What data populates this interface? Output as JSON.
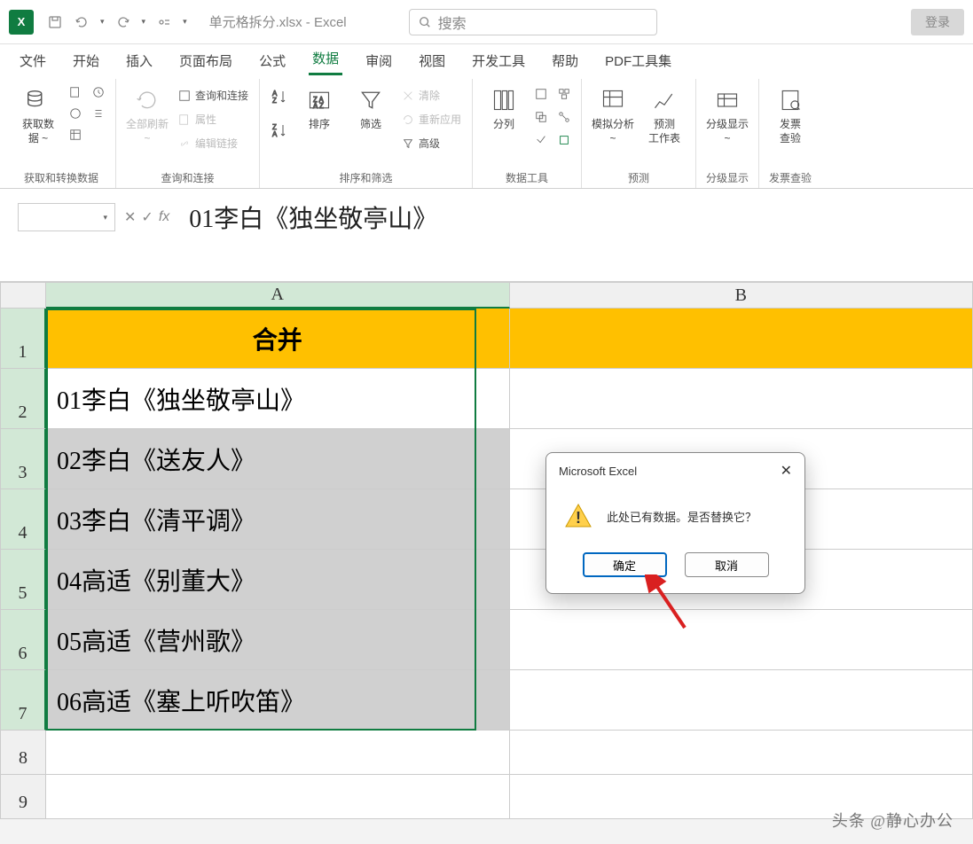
{
  "titlebar": {
    "app_logo": "X",
    "filename": "单元格拆分.xlsx",
    "app_name": "Excel",
    "title_sep": " - ",
    "search_placeholder": "搜索",
    "login_label": "登录"
  },
  "tabs": {
    "items": [
      {
        "label": "文件"
      },
      {
        "label": "开始"
      },
      {
        "label": "插入"
      },
      {
        "label": "页面布局"
      },
      {
        "label": "公式"
      },
      {
        "label": "数据",
        "active": true
      },
      {
        "label": "审阅"
      },
      {
        "label": "视图"
      },
      {
        "label": "开发工具"
      },
      {
        "label": "帮助"
      },
      {
        "label": "PDF工具集"
      }
    ]
  },
  "ribbon": {
    "groups": [
      {
        "label": "获取和转换数据",
        "btns": [
          {
            "t": "lg",
            "label": "获取数\n据 ~"
          }
        ]
      },
      {
        "label": "查询和连接",
        "btns": [
          {
            "t": "lg",
            "label": "全部刷新\n~",
            "disabled": true
          },
          {
            "t": "stack",
            "items": [
              {
                "label": "查询和连接"
              },
              {
                "label": "属性",
                "disabled": true
              },
              {
                "label": "编辑链接",
                "disabled": true
              }
            ]
          }
        ]
      },
      {
        "label": "排序和筛选",
        "btns": [
          {
            "t": "lg",
            "label": "排序"
          },
          {
            "t": "lg",
            "label": "筛选"
          },
          {
            "t": "stack",
            "items": [
              {
                "label": "清除",
                "disabled": true
              },
              {
                "label": "重新应用",
                "disabled": true
              },
              {
                "label": "高级"
              }
            ]
          }
        ]
      },
      {
        "label": "数据工具",
        "btns": [
          {
            "t": "lg",
            "label": "分列"
          }
        ]
      },
      {
        "label": "预测",
        "btns": [
          {
            "t": "lg",
            "label": "模拟分析\n~"
          },
          {
            "t": "lg",
            "label": "预测\n工作表"
          }
        ]
      },
      {
        "label": "分级显示",
        "btns": [
          {
            "t": "lg",
            "label": "分级显示\n~"
          }
        ]
      },
      {
        "label": "发票查验",
        "btns": [
          {
            "t": "lg",
            "label": "发票\n查验"
          }
        ]
      }
    ]
  },
  "formula_bar": {
    "namebox_value": "",
    "fx_label": "fx",
    "formula_value": "01李白《独坐敬亭山》"
  },
  "grid": {
    "columns": [
      "A",
      "B"
    ],
    "header_row_num": "1",
    "header_cell": "合并",
    "rows": [
      {
        "n": "2",
        "a": "01李白《独坐敬亭山》",
        "b": ""
      },
      {
        "n": "3",
        "a": "02李白《送友人》",
        "b": ""
      },
      {
        "n": "4",
        "a": "03李白《清平调》",
        "b": ""
      },
      {
        "n": "5",
        "a": "04高适《别董大》",
        "b": ""
      },
      {
        "n": "6",
        "a": "05高适《营州歌》",
        "b": ""
      },
      {
        "n": "7",
        "a": "06高适《塞上听吹笛》",
        "b": ""
      }
    ],
    "empty_rows": [
      "8",
      "9"
    ]
  },
  "dialog": {
    "title": "Microsoft Excel",
    "message": "此处已有数据。是否替换它？",
    "ok": "确定",
    "cancel": "取消"
  },
  "watermark": "头条 @静心办公"
}
